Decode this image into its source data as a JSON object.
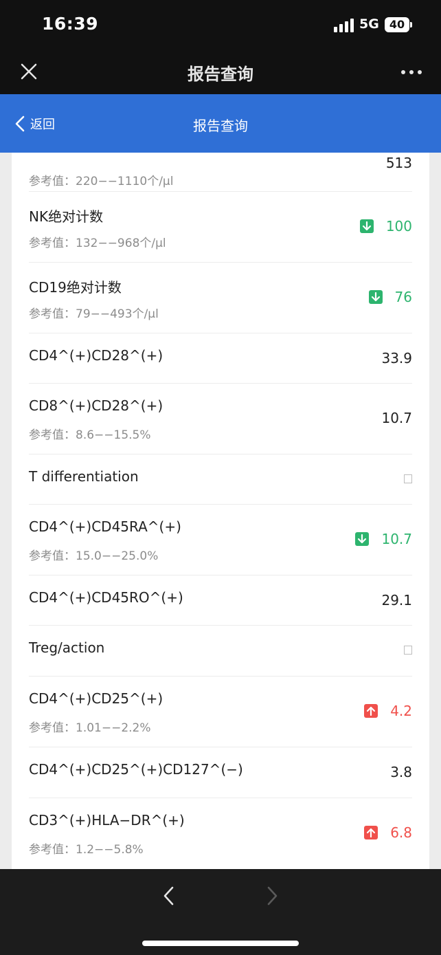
{
  "status_bar": {
    "time": "16:39",
    "network": "5G",
    "battery": "40"
  },
  "wechat_bar": {
    "title": "报告查询"
  },
  "header": {
    "back_label": "返回",
    "title": "报告查询"
  },
  "rows": [
    {
      "name": "",
      "ref": "参考值：220−−1110个/µl",
      "value": "513",
      "flag": "none"
    },
    {
      "name": "NK绝对计数",
      "ref": "参考值：132−−968个/µl",
      "value": "100",
      "flag": "down"
    },
    {
      "name": "CD19绝对计数",
      "ref": "参考值：79−−493个/µl",
      "value": "76",
      "flag": "down"
    },
    {
      "name": "CD4^(+)CD28^(+)",
      "ref": "",
      "value": "33.9",
      "flag": "none"
    },
    {
      "name": "CD8^(+)CD28^(+)",
      "ref": "参考值：8.6−−15.5%",
      "value": "10.7",
      "flag": "none"
    },
    {
      "name": "T differentiation",
      "ref": "",
      "value": "",
      "flag": "empty"
    },
    {
      "name": "CD4^(+)CD45RA^(+)",
      "ref": "参考值：15.0−−25.0%",
      "value": "10.7",
      "flag": "down"
    },
    {
      "name": "CD4^(+)CD45RO^(+)",
      "ref": "",
      "value": "29.1",
      "flag": "none"
    },
    {
      "name": "Treg/action",
      "ref": "",
      "value": "",
      "flag": "empty"
    },
    {
      "name": "CD4^(+)CD25^(+)",
      "ref": "参考值：1.01−−2.2%",
      "value": "4.2",
      "flag": "up"
    },
    {
      "name": "CD4^(+)CD25^(+)CD127^(−)",
      "ref": "",
      "value": "3.8",
      "flag": "none"
    },
    {
      "name": "CD3^(+)HLA−DR^(+)",
      "ref": "参考值：1.2−−5.8%",
      "value": "6.8",
      "flag": "up"
    }
  ],
  "colors": {
    "header_blue": "#2f6fd6",
    "down_green": "#2db46e",
    "up_red": "#f0504b"
  },
  "icons": {
    "close": "close-icon",
    "more": "more-icon",
    "back": "chevron-left-icon",
    "down": "arrow-down-icon",
    "up": "arrow-up-icon"
  }
}
